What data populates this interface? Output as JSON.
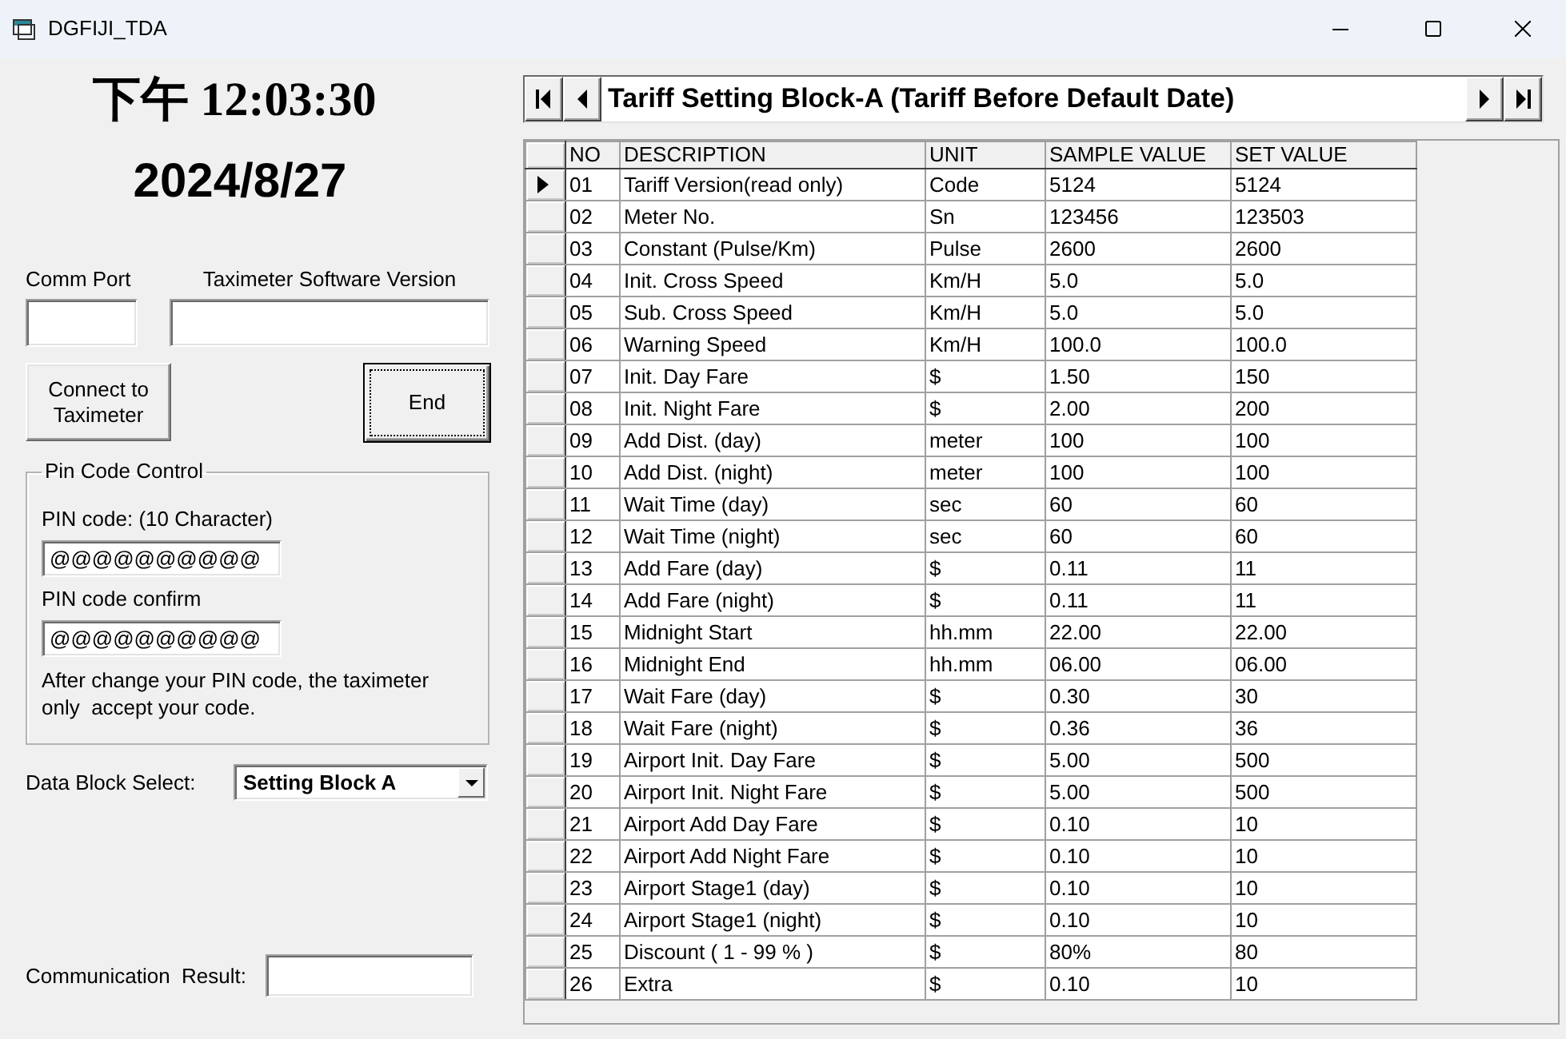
{
  "window": {
    "title": "DGFIJI_TDA"
  },
  "clock": {
    "time": "下午 12:03:30",
    "date": "2024/8/27"
  },
  "connection": {
    "comm_port": {
      "label": "Comm Port"
    },
    "software_version": {
      "label": "Taximeter Software Version"
    },
    "buttons": [
      {
        "label": "Connect to Taximeter",
        "focused": false
      },
      {
        "label": "End",
        "focused": true
      }
    ]
  },
  "pin_code_control": {
    "title": "Pin Code Control",
    "fields": [
      {
        "label": "PIN code: (10 Character)",
        "value": "@@@@@@@@@@"
      },
      {
        "label": "PIN code confirm",
        "value": "@@@@@@@@@@"
      }
    ],
    "note": "After change your PIN code, the taximeter only  accept your code."
  },
  "data_block_select": {
    "label": "Data Block Select:",
    "value": "Setting Block A"
  },
  "communication_result": {
    "label": "Communication  Result:"
  },
  "navigator": {
    "caption": "Tariff Setting Block-A (Tariff Before Default Date)"
  },
  "table": {
    "columns": [
      "NO",
      "DESCRIPTION",
      "UNIT",
      "SAMPLE VALUE",
      "SET VALUE"
    ],
    "rows": [
      {
        "cells": [
          "01",
          "Tariff Version(read only)",
          "Code",
          "5124",
          "5124"
        ],
        "selected": true
      },
      {
        "cells": [
          "02",
          "Meter No.",
          "Sn",
          "123456",
          "123503"
        ],
        "selected": false
      },
      {
        "cells": [
          "03",
          "Constant (Pulse/Km)",
          "Pulse",
          "2600",
          "2600"
        ],
        "selected": false
      },
      {
        "cells": [
          "04",
          "Init. Cross Speed",
          "Km/H",
          "5.0",
          "5.0"
        ],
        "selected": false
      },
      {
        "cells": [
          "05",
          "Sub. Cross Speed",
          "Km/H",
          "5.0",
          "5.0"
        ],
        "selected": false
      },
      {
        "cells": [
          "06",
          "Warning Speed",
          "Km/H",
          "100.0",
          "100.0"
        ],
        "selected": false
      },
      {
        "cells": [
          "07",
          "Init. Day Fare",
          "$",
          "1.50",
          "150"
        ],
        "selected": false
      },
      {
        "cells": [
          "08",
          "Init. Night Fare",
          "$",
          "2.00",
          "200"
        ],
        "selected": false
      },
      {
        "cells": [
          "09",
          "Add Dist. (day)",
          "meter",
          "100",
          "100"
        ],
        "selected": false
      },
      {
        "cells": [
          "10",
          "Add Dist. (night)",
          "meter",
          "100",
          "100"
        ],
        "selected": false
      },
      {
        "cells": [
          "11",
          "Wait Time (day)",
          "sec",
          "60",
          "60"
        ],
        "selected": false
      },
      {
        "cells": [
          "12",
          "Wait Time (night)",
          "sec",
          "60",
          "60"
        ],
        "selected": false
      },
      {
        "cells": [
          "13",
          "Add Fare (day)",
          "$",
          "0.11",
          "11"
        ],
        "selected": false
      },
      {
        "cells": [
          "14",
          "Add Fare (night)",
          "$",
          "0.11",
          "11"
        ],
        "selected": false
      },
      {
        "cells": [
          "15",
          "Midnight Start",
          "hh.mm",
          "22.00",
          "22.00"
        ],
        "selected": false
      },
      {
        "cells": [
          "16",
          "Midnight End",
          "hh.mm",
          "06.00",
          "06.00"
        ],
        "selected": false
      },
      {
        "cells": [
          "17",
          "Wait Fare (day)",
          "$",
          "0.30",
          "30"
        ],
        "selected": false
      },
      {
        "cells": [
          "18",
          "Wait Fare (night)",
          "$",
          "0.36",
          "36"
        ],
        "selected": false
      },
      {
        "cells": [
          "19",
          "Airport Init. Day Fare",
          "$",
          "5.00",
          "500"
        ],
        "selected": false
      },
      {
        "cells": [
          "20",
          "Airport Init. Night Fare",
          "$",
          "5.00",
          "500"
        ],
        "selected": false
      },
      {
        "cells": [
          "21",
          "Airport Add Day Fare",
          "$",
          "0.10",
          "10"
        ],
        "selected": false
      },
      {
        "cells": [
          "22",
          "Airport Add Night Fare",
          "$",
          "0.10",
          "10"
        ],
        "selected": false
      },
      {
        "cells": [
          "23",
          "Airport Stage1 (day)",
          "$",
          "0.10",
          "10"
        ],
        "selected": false
      },
      {
        "cells": [
          "24",
          "Airport Stage1 (night)",
          "$",
          "0.10",
          "10"
        ],
        "selected": false
      },
      {
        "cells": [
          "25",
          "Discount ( 1 - 99 % )",
          "$",
          "80%",
          "80"
        ],
        "selected": false
      },
      {
        "cells": [
          "26",
          "Extra",
          "$",
          "0.10",
          "10"
        ],
        "selected": false
      }
    ]
  }
}
